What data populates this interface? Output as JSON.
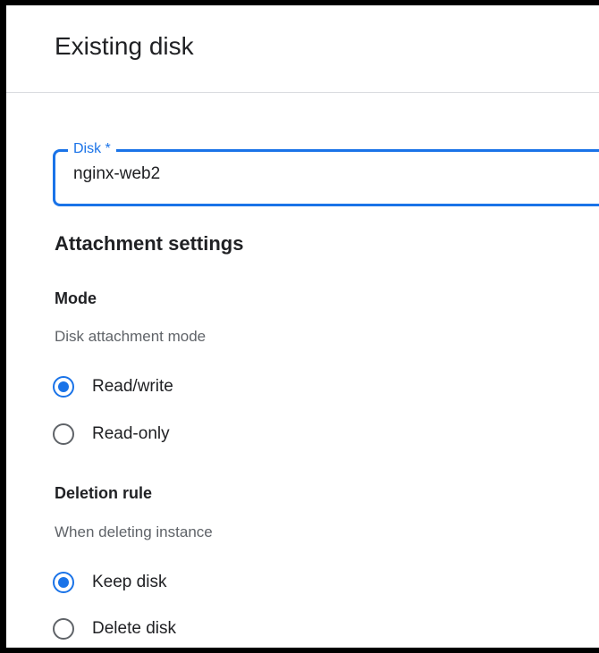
{
  "dialog": {
    "title": "Existing disk"
  },
  "disk_field": {
    "label": "Disk *",
    "value": "nginx-web2"
  },
  "attachment_settings": {
    "title": "Attachment settings",
    "mode": {
      "title": "Mode",
      "help": "Disk attachment mode",
      "options": [
        {
          "label": "Read/write",
          "selected": true
        },
        {
          "label": "Read-only",
          "selected": false
        }
      ]
    },
    "deletion_rule": {
      "title": "Deletion rule",
      "help": "When deleting instance",
      "options": [
        {
          "label": "Keep disk",
          "selected": true
        },
        {
          "label": "Delete disk",
          "selected": false
        }
      ]
    }
  },
  "colors": {
    "accent": "#1a73e8",
    "text": "#202124",
    "secondary_text": "#5f6368"
  }
}
